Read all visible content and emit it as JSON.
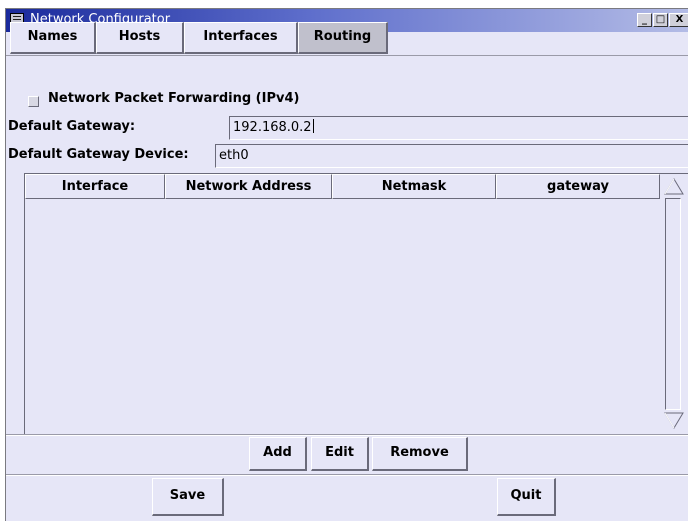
{
  "window": {
    "title": "Network Configurator"
  },
  "tabs": [
    {
      "label": "Names"
    },
    {
      "label": "Hosts"
    },
    {
      "label": "Interfaces"
    },
    {
      "label": "Routing"
    }
  ],
  "routing": {
    "forwarding_label": "Network Packet Forwarding (IPv4)",
    "forwarding_checked": false,
    "gateway_label": "Default Gateway:",
    "gateway_value": "192.168.0.2",
    "device_label": "Default Gateway Device:",
    "device_value": "eth0"
  },
  "routes_table": {
    "columns": [
      "Interface",
      "Network Address",
      "Netmask",
      "gateway"
    ],
    "rows": []
  },
  "route_buttons": {
    "add": "Add",
    "edit": "Edit",
    "remove": "Remove"
  },
  "footer": {
    "save": "Save",
    "quit": "Quit"
  }
}
